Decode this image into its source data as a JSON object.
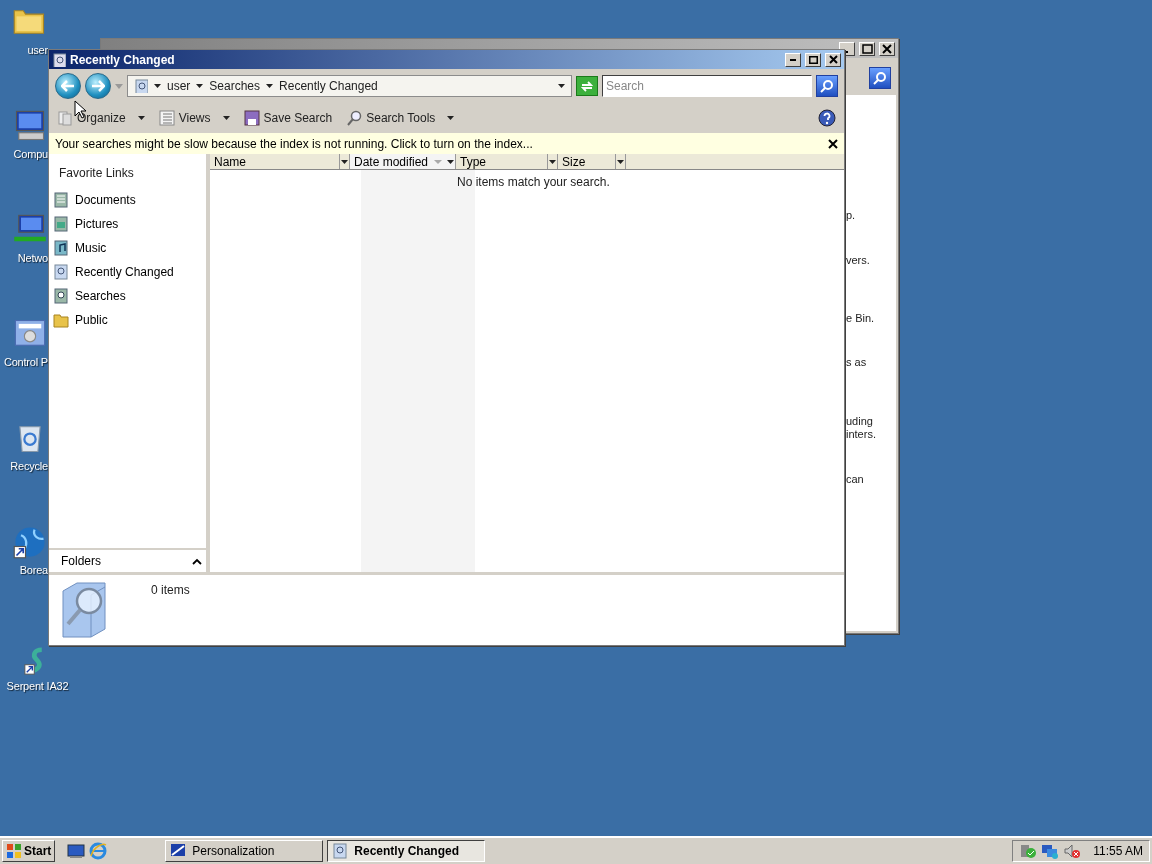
{
  "desktop_icons": [
    {
      "label": "user",
      "kind": "folder"
    },
    {
      "label": "Compu",
      "kind": "computer"
    },
    {
      "label": "Netwo",
      "kind": "network"
    },
    {
      "label": "Control P",
      "kind": "control"
    },
    {
      "label": "Recycle",
      "kind": "recycle"
    },
    {
      "label": "Borea",
      "kind": "globe"
    },
    {
      "label": "Serpent IA32",
      "kind": "serpent"
    }
  ],
  "back_window": {
    "text_fragments": [
      "p.",
      "vers.",
      "e Bin.",
      "s as",
      "uding",
      "inters.",
      "can"
    ]
  },
  "window": {
    "title": "Recently Changed",
    "breadcrumb": [
      "user",
      "Searches",
      "Recently Changed"
    ],
    "search": {
      "placeholder": "Search"
    },
    "toolbar": [
      {
        "label": "Organize",
        "kind": "organize",
        "dropdown": true
      },
      {
        "label": "Views",
        "kind": "views",
        "dropdown": true
      },
      {
        "label": "Save Search",
        "kind": "save",
        "dropdown": false
      },
      {
        "label": "Search Tools",
        "kind": "tools",
        "dropdown": true
      }
    ],
    "info_bar": "Your searches might be slow because the index is not running.  Click to turn on the index...",
    "favorite_links": {
      "title": "Favorite Links",
      "items": [
        {
          "label": "Documents",
          "kind": "documents"
        },
        {
          "label": "Pictures",
          "kind": "pictures"
        },
        {
          "label": "Music",
          "kind": "music"
        },
        {
          "label": "Recently Changed",
          "kind": "recent"
        },
        {
          "label": "Searches",
          "kind": "searches"
        },
        {
          "label": "Public",
          "kind": "folder"
        }
      ]
    },
    "folders": {
      "label": "Folders",
      "expanded": false
    },
    "columns": [
      {
        "label": "Name",
        "sorted": false
      },
      {
        "label": "Date modified",
        "sorted": true
      },
      {
        "label": "Type",
        "sorted": false
      },
      {
        "label": "Size",
        "sorted": false
      }
    ],
    "empty_message": "No items match your search.",
    "details": "0 items"
  },
  "taskbar": {
    "start": "Start",
    "tasks": [
      {
        "label": "Personalization",
        "kind": "display",
        "selected": false
      },
      {
        "label": "Recently Changed",
        "kind": "recent",
        "selected": true
      }
    ],
    "clock": "11:55 AM"
  }
}
